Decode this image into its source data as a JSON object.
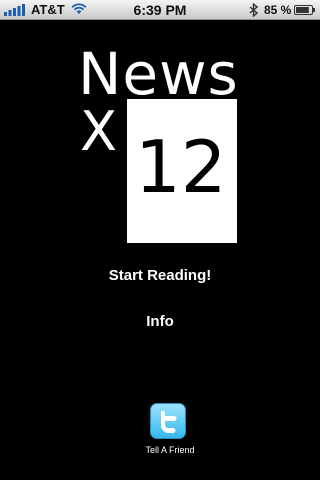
{
  "status_bar": {
    "carrier": "AT&T",
    "time": "6:39 PM",
    "battery_percent": "85 %",
    "battery_level": 0.85,
    "signal_icon": "signal-bars-icon",
    "wifi_icon": "wifi-icon",
    "bluetooth_icon": "bluetooth-icon",
    "battery_icon": "battery-icon"
  },
  "logo": {
    "word": "News",
    "letter": "X",
    "number": "12"
  },
  "menu": {
    "start_reading": "Start Reading!",
    "info": "Info"
  },
  "share": {
    "icon": "twitter-icon",
    "label": "Tell A Friend",
    "icon_color": "#35b8ec"
  },
  "colors": {
    "background": "#000000",
    "text": "#ffffff"
  }
}
